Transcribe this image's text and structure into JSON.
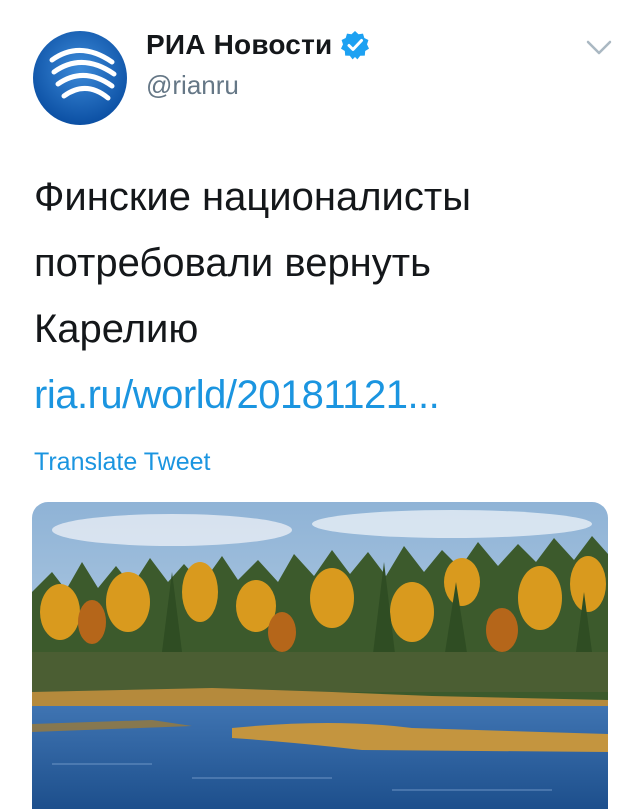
{
  "tweet": {
    "author": {
      "display_name": "РИА Новости",
      "handle": "@rianru",
      "verified": true,
      "avatar_icon": "ria-logo-icon"
    },
    "text_lines": [
      "Финские националисты",
      "потребовали вернуть",
      "Карелию"
    ],
    "link": "ria.ru/world/20181121...",
    "translate_label": "Translate Tweet",
    "media": {
      "description_icon": "autumn-forest-lake-photo"
    }
  },
  "colors": {
    "link_blue": "#1b95e0",
    "verified_blue": "#1da1f2",
    "text": "#14171a",
    "muted": "#657786"
  }
}
